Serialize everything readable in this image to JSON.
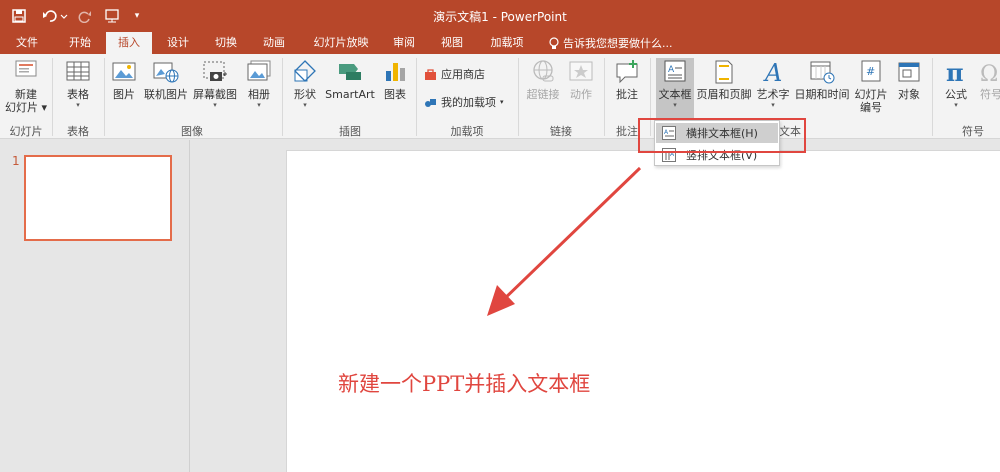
{
  "titlebar": {
    "title": "演示文稿1 - PowerPoint"
  },
  "tabs": [
    {
      "label": "文件"
    },
    {
      "label": "开始"
    },
    {
      "label": "插入"
    },
    {
      "label": "设计"
    },
    {
      "label": "切换"
    },
    {
      "label": "动画"
    },
    {
      "label": "幻灯片放映"
    },
    {
      "label": "审阅"
    },
    {
      "label": "视图"
    },
    {
      "label": "加载项"
    }
  ],
  "tell_me": "告诉我您想要做什么...",
  "ribbon": {
    "groups": {
      "slides": "幻灯片",
      "tables": "表格",
      "images": "图像",
      "illustrations": "插图",
      "addins": "加载项",
      "links": "链接",
      "comments": "批注",
      "text": "文本",
      "symbols": "符号"
    },
    "buttons": {
      "new_slide": [
        "新建",
        "幻灯片"
      ],
      "table": "表格",
      "picture": "图片",
      "online_picture": "联机图片",
      "screenshot": "屏幕截图",
      "album": "相册",
      "shapes": "形状",
      "smartart": "SmartArt",
      "chart": "图表",
      "store": "应用商店",
      "my_addins": "我的加载项",
      "hyperlink": "超链接",
      "action": "动作",
      "comment": "批注",
      "textbox": "文本框",
      "header_footer": "页眉和页脚",
      "wordart": "艺术字",
      "datetime": "日期和时间",
      "slide_number": [
        "幻灯片",
        "编号"
      ],
      "object": "对象",
      "equation": "公式",
      "symbol": "符号"
    }
  },
  "dropdown": {
    "items": [
      {
        "label": "横排文本框(H)"
      },
      {
        "label": "竖排文本框(V)"
      }
    ]
  },
  "slides_pane": {
    "slide_number": "1"
  },
  "canvas": {
    "annotation": "新建一个PPT并插入文本框"
  },
  "colors": {
    "accent": "#b7472a",
    "annotation_red": "#e0463f"
  }
}
